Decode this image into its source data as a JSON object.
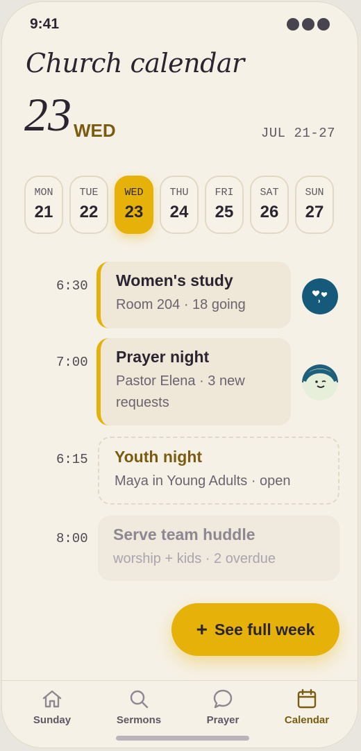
{
  "status": {
    "time": "9:41"
  },
  "header": {
    "title": "Church calendar",
    "day_number": "23",
    "day_name": "WED",
    "week_range": "JUL 21-27"
  },
  "week": [
    {
      "name": "MON",
      "num": "21"
    },
    {
      "name": "TUE",
      "num": "22"
    },
    {
      "name": "WED",
      "num": "23",
      "selected": true
    },
    {
      "name": "THU",
      "num": "24"
    },
    {
      "name": "FRI",
      "num": "25"
    },
    {
      "name": "SAT",
      "num": "26"
    },
    {
      "name": "SUN",
      "num": "27"
    }
  ],
  "events": [
    {
      "time": "6:30",
      "title": "Women's study",
      "subtitle": "Room 204 · 18 going",
      "style": "solid",
      "avatar": "hearts-avatar"
    },
    {
      "time": "7:00",
      "title": "Prayer night",
      "subtitle": "Pastor Elena · 3 new requests",
      "style": "solid",
      "avatar": "smile-avatar"
    },
    {
      "time": "6:15",
      "title": "Youth night",
      "subtitle": "Maya in Young Adults · open",
      "style": "dashed"
    },
    {
      "time": "8:00",
      "title": "Serve team huddle",
      "subtitle": "worship + kids · 2 overdue",
      "style": "muted"
    }
  ],
  "fab": {
    "icon": "plus-icon",
    "label": "See full week"
  },
  "tabs": [
    {
      "label": "Sunday",
      "icon": "home-icon"
    },
    {
      "label": "Sermons",
      "icon": "search-icon"
    },
    {
      "label": "Prayer",
      "icon": "chat-bubble-icon"
    },
    {
      "label": "Calendar",
      "icon": "calendar-icon",
      "active": true
    }
  ],
  "colors": {
    "background": "#f6f1e6",
    "accent": "#e6b20a",
    "accent_text": "#7a5c10",
    "text": "#2a2530",
    "muted_text": "#6a6470"
  }
}
